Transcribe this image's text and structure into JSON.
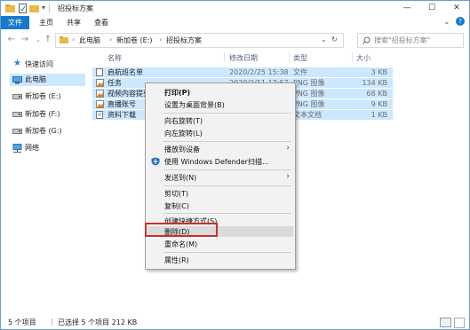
{
  "window": {
    "title": "招投标方案",
    "buttons": {
      "minimize": "—",
      "maximize": "☐",
      "close": "✕"
    }
  },
  "ribbon": {
    "tabs": [
      {
        "label": "文件",
        "active": true
      },
      {
        "label": "主页"
      },
      {
        "label": "共享"
      },
      {
        "label": "查看"
      }
    ]
  },
  "address": {
    "breadcrumbs": [
      "此电脑",
      "新加卷 (E:)",
      "招投标方案"
    ],
    "search_placeholder": "搜索\"招投标方案\""
  },
  "nav": {
    "items": [
      {
        "label": "快速访问"
      },
      {
        "label": "此电脑",
        "selected": true
      },
      {
        "label": "新加卷 (E:)"
      },
      {
        "label": "新加卷 (F:)"
      },
      {
        "label": "新加卷 (G:)"
      },
      {
        "label": "网络"
      }
    ]
  },
  "columns": {
    "name": "名称",
    "modified": "修改日期",
    "type": "类型",
    "size": "大小"
  },
  "files": [
    {
      "name": "启航班名单",
      "modified": "2020/2/25 15:38",
      "type": "文件",
      "size": "3 KB",
      "icon": "doc-icon"
    },
    {
      "name": "任务",
      "modified": "2020/2/11 17:57",
      "type": "PNG 图像",
      "size": "134 KB",
      "icon": "png-icon"
    },
    {
      "name": "视频内容提要",
      "modified": "",
      "type": "PNG 图像",
      "size": "68 KB",
      "icon": "png-icon"
    },
    {
      "name": "直播账号",
      "modified": "",
      "type": "PNG 图像",
      "size": "9 KB",
      "icon": "png-icon"
    },
    {
      "name": "资料下载",
      "modified": "",
      "type": "文本文档",
      "size": "1 KB",
      "icon": "txt-icon"
    }
  ],
  "context_menu": {
    "items": [
      {
        "label": "打印(P)",
        "bold": true
      },
      {
        "label": "设置为桌面背景(B)"
      },
      {
        "label": "向右旋转(T)"
      },
      {
        "label": "向左旋转(L)"
      },
      {
        "label": "播放到设备",
        "submenu": true
      },
      {
        "label": "使用 Windows Defender扫描...",
        "icon": "defender-icon"
      },
      {
        "label": "发送到(N)",
        "submenu": true
      },
      {
        "label": "剪切(T)"
      },
      {
        "label": "复制(C)"
      },
      {
        "label": "创建快捷方式(S)"
      },
      {
        "label": "删除(D)",
        "highlighted": true
      },
      {
        "label": "重命名(M)"
      },
      {
        "label": "属性(R)"
      }
    ]
  },
  "status": {
    "item_count": "5 个项目",
    "selected": "已选择 5 个项目  212 KB"
  },
  "colors": {
    "accent": "#1979ca",
    "selection": "#cce8ff",
    "highlight_box": "#c8302b"
  }
}
